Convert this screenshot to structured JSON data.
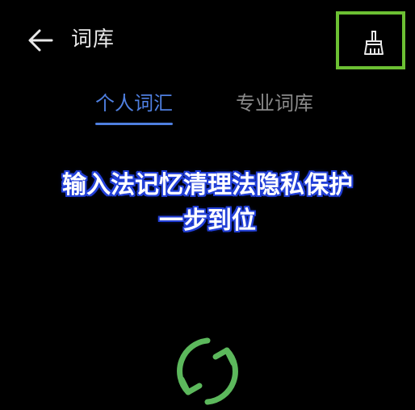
{
  "header": {
    "title": "词库",
    "back_icon": "arrow-left-icon",
    "clean_icon": "brush-icon",
    "highlight_color": "#6cc033"
  },
  "tabs": [
    {
      "label": "个人词汇",
      "active": true
    },
    {
      "label": "专业词库",
      "active": false
    }
  ],
  "colors": {
    "accent": "#4f7fe0",
    "inactive_tab": "#8a8a8a",
    "background": "#000000",
    "caption_outline": "#2340d8",
    "loading_ring": "#5cb85c"
  },
  "caption": {
    "line1": "输入法记忆清理法隐私保护",
    "line2": "一步到位"
  },
  "loading": {
    "icon": "refresh-icon"
  }
}
